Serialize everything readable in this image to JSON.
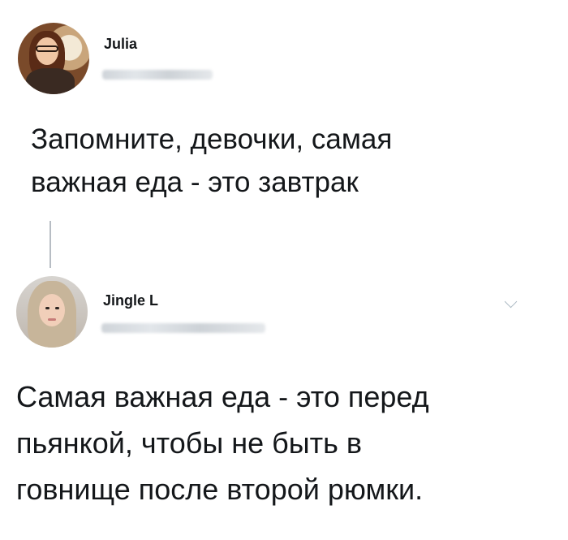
{
  "tweets": [
    {
      "author_name": "Julia",
      "text": "Запомните, девочки, самая\nважная еда - это завтрак"
    },
    {
      "author_name": "Jingle L",
      "text": "Самая важная еда - это перед\nпьянкой, чтобы не быть в\nговнище после второй рюмки."
    }
  ],
  "icons": {
    "more_menu": "chevron-down-icon"
  },
  "colors": {
    "text": "#14171a",
    "thread_line": "#b7bdc4",
    "caret": "#aab8c2"
  }
}
